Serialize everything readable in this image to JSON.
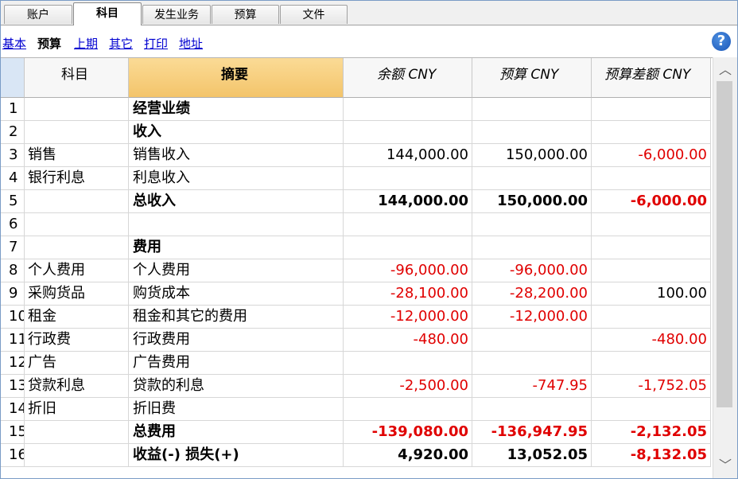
{
  "tabs": [
    "账户",
    "科目",
    "发生业务",
    "预算",
    "文件"
  ],
  "active_tab": 1,
  "subtabs": [
    "基本",
    "预算",
    "上期",
    "其它",
    "打印",
    "地址"
  ],
  "active_subtab": 1,
  "help_icon": "?",
  "columns": [
    "科目",
    "摘要",
    "余额 CNY",
    "预算 CNY",
    "预算差额 CNY"
  ],
  "rows": [
    {
      "n": "1",
      "acct": "",
      "desc": "经营业绩",
      "bal": "",
      "bud": "",
      "diff": "",
      "bold": true
    },
    {
      "n": "2",
      "acct": "",
      "desc": "收入",
      "bal": "",
      "bud": "",
      "diff": "",
      "bold": true
    },
    {
      "n": "3",
      "acct": "销售",
      "desc": "销售收入",
      "bal": "144,000.00",
      "bud": "150,000.00",
      "diff": "-6,000.00",
      "bold": false
    },
    {
      "n": "4",
      "acct": "银行利息",
      "desc": "利息收入",
      "bal": "",
      "bud": "",
      "diff": "",
      "bold": false
    },
    {
      "n": "5",
      "acct": "",
      "desc": "总收入",
      "bal": "144,000.00",
      "bud": "150,000.00",
      "diff": "-6,000.00",
      "bold": true
    },
    {
      "n": "6",
      "acct": "",
      "desc": "",
      "bal": "",
      "bud": "",
      "diff": "",
      "bold": false
    },
    {
      "n": "7",
      "acct": "",
      "desc": "费用",
      "bal": "",
      "bud": "",
      "diff": "",
      "bold": true
    },
    {
      "n": "8",
      "acct": "个人费用",
      "desc": "个人费用",
      "bal": "-96,000.00",
      "bud": "-96,000.00",
      "diff": "",
      "bold": false
    },
    {
      "n": "9",
      "acct": "采购货品",
      "desc": "购货成本",
      "bal": "-28,100.00",
      "bud": "-28,200.00",
      "diff": "100.00",
      "bold": false
    },
    {
      "n": "10",
      "acct": "租金",
      "desc": "租金和其它的费用",
      "bal": "-12,000.00",
      "bud": "-12,000.00",
      "diff": "",
      "bold": false
    },
    {
      "n": "11",
      "acct": "行政费",
      "desc": "行政费用",
      "bal": "-480.00",
      "bud": "",
      "diff": "-480.00",
      "bold": false
    },
    {
      "n": "12",
      "acct": "广告",
      "desc": "广告费用",
      "bal": "",
      "bud": "",
      "diff": "",
      "bold": false
    },
    {
      "n": "13",
      "acct": "贷款利息",
      "desc": "贷款的利息",
      "bal": "-2,500.00",
      "bud": "-747.95",
      "diff": "-1,752.05",
      "bold": false
    },
    {
      "n": "14",
      "acct": "折旧",
      "desc": "折旧费",
      "bal": "",
      "bud": "",
      "diff": "",
      "bold": false
    },
    {
      "n": "15",
      "acct": "",
      "desc": "总费用",
      "bal": "-139,080.00",
      "bud": "-136,947.95",
      "diff": "-2,132.05",
      "bold": true
    },
    {
      "n": "16",
      "acct": "",
      "desc": "收益(-) 损失(+)",
      "bal": "4,920.00",
      "bud": "13,052.05",
      "diff": "-8,132.05",
      "bold": true
    }
  ],
  "scroll": {
    "up": "︿",
    "down": "﹀"
  }
}
